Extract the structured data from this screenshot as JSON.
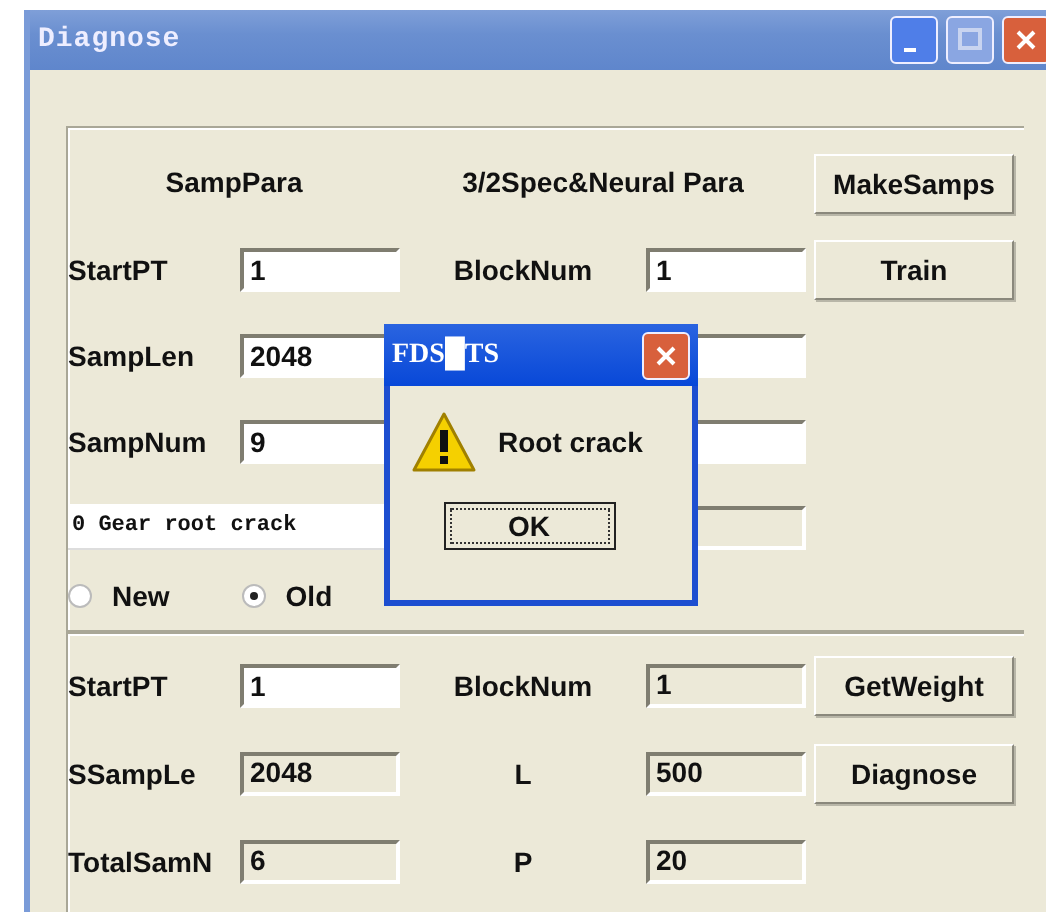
{
  "window": {
    "title": "Diagnose"
  },
  "samp_para": {
    "heading": "SampPara",
    "fields": [
      {
        "label": "StartPT",
        "value": "1"
      },
      {
        "label": "SampLen",
        "value": "2048"
      },
      {
        "label": "SampNum",
        "value": "9"
      }
    ],
    "description": "0 Gear root crack",
    "radios": [
      {
        "label": "New",
        "selected": false
      },
      {
        "label": "Old",
        "selected": true
      }
    ]
  },
  "spec_para": {
    "heading": "3/2Spec&Neural Para",
    "fields": [
      {
        "label": "BlockNum",
        "value": "1"
      }
    ]
  },
  "train_buttons": [
    "MakeSamps",
    "Train"
  ],
  "diagnose_para": {
    "rows": [
      {
        "label": "StartPT",
        "value": "1",
        "editable": true,
        "right_label": "BlockNum",
        "right_value": "1"
      },
      {
        "label": "SSampLe",
        "value": "2048",
        "editable": false,
        "right_label": "L",
        "right_value": "500"
      },
      {
        "label": "TotalSamN",
        "value": "6",
        "editable": false,
        "right_label": "P",
        "right_value": "20"
      }
    ]
  },
  "diagnose_buttons": [
    "GetWeight",
    "Diagnose"
  ],
  "message_box": {
    "title": "FDS█TS",
    "message": "Root crack",
    "button": "OK"
  }
}
